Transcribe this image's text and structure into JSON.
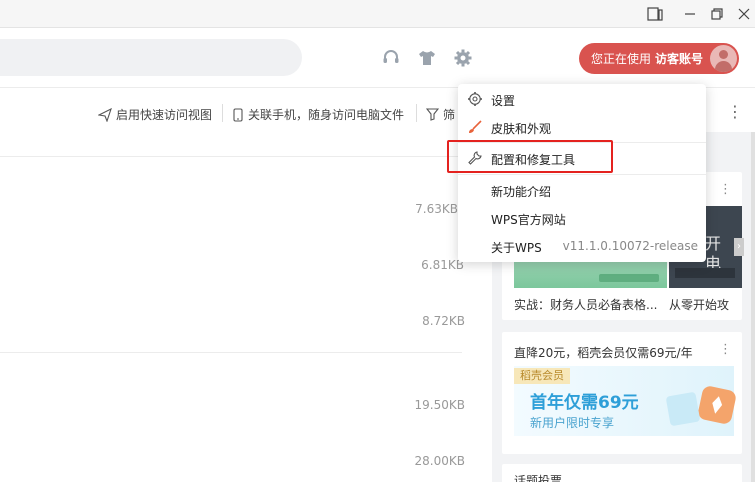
{
  "header": {
    "user": {
      "prefix": "您正在使用",
      "account": "访客账号"
    }
  },
  "toolbar": {
    "quick_access": "启用快速访问视图",
    "link_phone": "关联手机，随身访问电脑文件",
    "filter": "筛"
  },
  "files": {
    "sizes": [
      "7.63KB",
      "6.81KB",
      "8.72KB",
      "19.50KB",
      "28.00KB"
    ]
  },
  "cards": {
    "card1": {
      "caption_left": "实战：财务人员必备表格...",
      "caption_right": "从零开始攻",
      "thumb_right_text1": "开",
      "thumb_right_text2": "电"
    },
    "card2": {
      "title": "直降20元，稻壳会员仅需69元/年",
      "badge": "稻壳会员",
      "headline": "首年仅需69元",
      "subline": "新用户限时专享"
    },
    "card3": {
      "title": "话题投票"
    }
  },
  "menu": {
    "items": [
      {
        "label": "设置",
        "icon": "gear-icon"
      },
      {
        "label": "皮肤和外观",
        "icon": "brush-icon"
      },
      {
        "label": "配置和修复工具",
        "icon": "wrench-icon"
      },
      {
        "label": "新功能介绍"
      },
      {
        "label": "WPS官方网站"
      },
      {
        "label": "关于WPS",
        "version": "v11.1.0.10072-release"
      }
    ]
  },
  "colors": {
    "accent": "#d9534f",
    "highlight": "#e4221f",
    "brush": "#e8623a"
  }
}
